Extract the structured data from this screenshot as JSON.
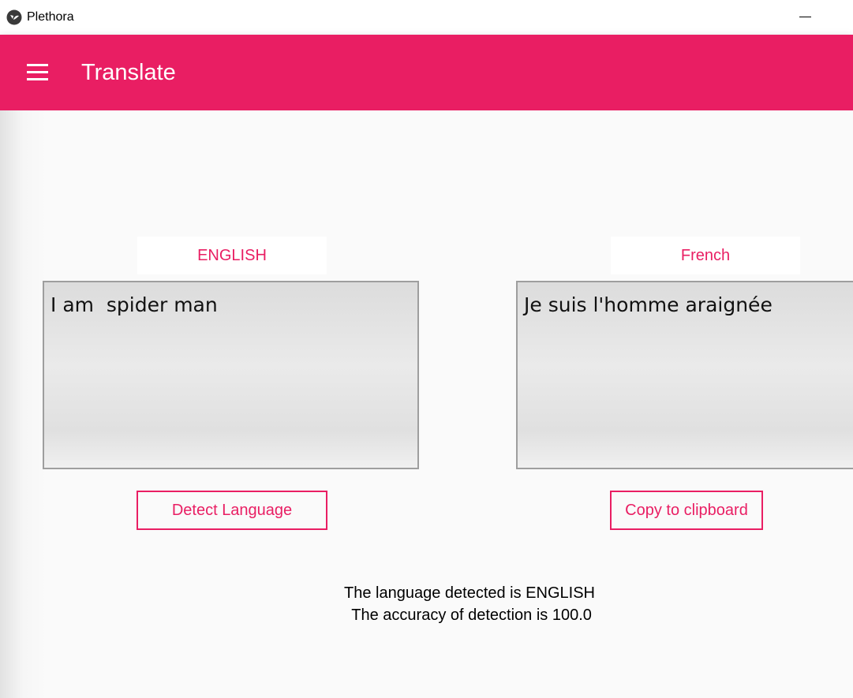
{
  "window": {
    "title": "Plethora",
    "minimize_icon": "minimize-icon",
    "app_icon": "kivy-logo-icon"
  },
  "appbar": {
    "menu_icon": "hamburger-menu-icon",
    "title": "Translate",
    "color": "#e91e63"
  },
  "source": {
    "language": "ENGLISH",
    "text": "I am  spider man",
    "button_label": "Detect Language"
  },
  "target": {
    "language": "French",
    "text": "Je suis l'homme araignée",
    "button_label": "Copy to clipboard"
  },
  "status": {
    "line1": "The language detected is ENGLISH",
    "line2": " The accuracy of detection is 100.0"
  }
}
